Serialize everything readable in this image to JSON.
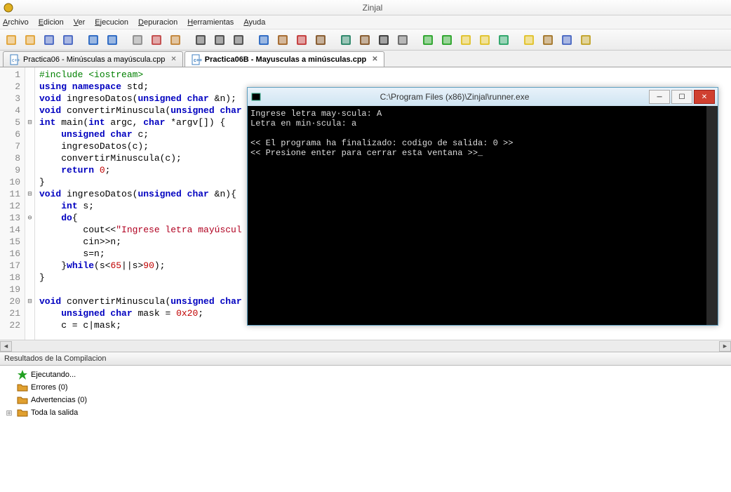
{
  "window": {
    "title": "Zinjal"
  },
  "menu": [
    "Archivo",
    "Edicion",
    "Ver",
    "Ejecucion",
    "Depuracion",
    "Herramientas",
    "Ayuda"
  ],
  "tabs": [
    {
      "label": "Practica06 - Minúsculas a mayúscula.cpp",
      "active": false
    },
    {
      "label": "Practica06B - Mayusculas a minúsculas.cpp",
      "active": true
    }
  ],
  "code_lines": [
    {
      "n": 1,
      "fold": "",
      "tokens": [
        [
          "kw-green",
          "#include <iostream>"
        ]
      ]
    },
    {
      "n": 2,
      "fold": "",
      "tokens": [
        [
          "kw-blue",
          "using namespace"
        ],
        [
          "",
          " std;"
        ]
      ]
    },
    {
      "n": 3,
      "fold": "",
      "tokens": [
        [
          "kw-blue",
          "void"
        ],
        [
          "",
          " ingresoDatos("
        ],
        [
          "kw-blue",
          "unsigned char"
        ],
        [
          "",
          " &n);"
        ]
      ]
    },
    {
      "n": 4,
      "fold": "",
      "tokens": [
        [
          "kw-blue",
          "void"
        ],
        [
          "",
          " convertirMinuscula("
        ],
        [
          "kw-blue",
          "unsigned char"
        ]
      ]
    },
    {
      "n": 5,
      "fold": "⊟",
      "tokens": [
        [
          "kw-blue",
          "int"
        ],
        [
          "",
          " main("
        ],
        [
          "kw-blue",
          "int"
        ],
        [
          "",
          " argc, "
        ],
        [
          "kw-blue",
          "char"
        ],
        [
          "",
          " *argv[]) {"
        ]
      ]
    },
    {
      "n": 6,
      "fold": "",
      "tokens": [
        [
          "",
          "    "
        ],
        [
          "kw-blue",
          "unsigned char"
        ],
        [
          "",
          " c;"
        ]
      ]
    },
    {
      "n": 7,
      "fold": "",
      "tokens": [
        [
          "",
          "    ingresoDatos(c);"
        ]
      ]
    },
    {
      "n": 8,
      "fold": "",
      "tokens": [
        [
          "",
          "    convertirMinuscula(c);"
        ]
      ]
    },
    {
      "n": 9,
      "fold": "",
      "tokens": [
        [
          "",
          "    "
        ],
        [
          "kw-blue",
          "return"
        ],
        [
          "",
          " "
        ],
        [
          "kw-num",
          "0"
        ],
        [
          "",
          ";"
        ]
      ]
    },
    {
      "n": 10,
      "fold": "",
      "tokens": [
        [
          "",
          "}"
        ]
      ]
    },
    {
      "n": 11,
      "fold": "⊟",
      "tokens": [
        [
          "kw-blue",
          "void"
        ],
        [
          "",
          " ingresoDatos("
        ],
        [
          "kw-blue",
          "unsigned char"
        ],
        [
          "",
          " &n){"
        ]
      ]
    },
    {
      "n": 12,
      "fold": "",
      "tokens": [
        [
          "",
          "    "
        ],
        [
          "kw-blue",
          "int"
        ],
        [
          "",
          " s;"
        ]
      ]
    },
    {
      "n": 13,
      "fold": "⊖",
      "tokens": [
        [
          "",
          "    "
        ],
        [
          "kw-blue",
          "do"
        ],
        [
          "",
          "{"
        ]
      ]
    },
    {
      "n": 14,
      "fold": "",
      "tokens": [
        [
          "",
          "        cout<<"
        ],
        [
          "kw-str",
          "\"Ingrese letra mayúscul"
        ]
      ]
    },
    {
      "n": 15,
      "fold": "",
      "tokens": [
        [
          "",
          "        cin>>n;"
        ]
      ]
    },
    {
      "n": 16,
      "fold": "",
      "tokens": [
        [
          "",
          "        s=n;"
        ]
      ]
    },
    {
      "n": 17,
      "fold": "",
      "tokens": [
        [
          "",
          "    }"
        ],
        [
          "kw-blue",
          "while"
        ],
        [
          "",
          "(s<"
        ],
        [
          "kw-num",
          "65"
        ],
        [
          "",
          "||s>"
        ],
        [
          "kw-num",
          "90"
        ],
        [
          "",
          ");"
        ]
      ]
    },
    {
      "n": 18,
      "fold": "",
      "tokens": [
        [
          "",
          "}"
        ]
      ]
    },
    {
      "n": 19,
      "fold": "",
      "tokens": [
        [
          "",
          ""
        ]
      ]
    },
    {
      "n": 20,
      "fold": "⊟",
      "tokens": [
        [
          "kw-blue",
          "void"
        ],
        [
          "",
          " convertirMinuscula("
        ],
        [
          "kw-blue",
          "unsigned char"
        ]
      ]
    },
    {
      "n": 21,
      "fold": "",
      "tokens": [
        [
          "",
          "    "
        ],
        [
          "kw-blue",
          "unsigned char"
        ],
        [
          "",
          " mask = "
        ],
        [
          "kw-num",
          "0x20"
        ],
        [
          "",
          ";"
        ]
      ]
    },
    {
      "n": 22,
      "fold": "",
      "tokens": [
        [
          "",
          "    c = c|mask;"
        ]
      ]
    }
  ],
  "console": {
    "title": "C:\\Program Files (x86)\\Zinjal\\runner.exe",
    "lines": [
      "Ingrese letra may·scula: A",
      "Letra en min·scula: a",
      "",
      "<< El programa ha finalizado: codigo de salida: 0 >>",
      "<< Presione enter para cerrar esta ventana >>_"
    ]
  },
  "panel": {
    "title": "Resultados de la Compilacion",
    "items": [
      {
        "icon": "star",
        "label": "Ejecutando..."
      },
      {
        "icon": "folder",
        "label": "Errores (0)"
      },
      {
        "icon": "folder",
        "label": "Advertencias (0)"
      },
      {
        "icon": "folder",
        "label": "Toda la salida",
        "expander": "⊞"
      }
    ]
  },
  "toolbar_icons": [
    "new-file",
    "open-file",
    "save-file",
    "save-all",
    "sep",
    "undo",
    "redo",
    "sep",
    "copy",
    "cut",
    "paste",
    "sep",
    "find",
    "replace",
    "find-next",
    "sep",
    "compile",
    "debug",
    "breakpoint",
    "step",
    "sep",
    "run-config",
    "books",
    "terminal",
    "config",
    "sep",
    "run-green",
    "stop-green",
    "play",
    "mark",
    "bug",
    "sep",
    "mark1",
    "mark2",
    "help",
    "mail"
  ]
}
